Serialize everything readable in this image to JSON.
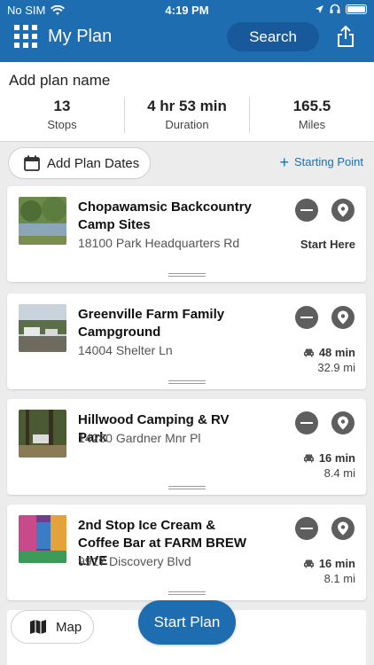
{
  "status_bar": {
    "carrier": "No SIM",
    "time": "4:19 PM"
  },
  "nav": {
    "title": "My Plan",
    "search_label": "Search"
  },
  "plan": {
    "name_placeholder": "Add plan name",
    "stats": [
      {
        "value": "13",
        "label": "Stops"
      },
      {
        "value": "4 hr 53 min",
        "label": "Duration"
      },
      {
        "value": "165.5",
        "label": "Miles"
      }
    ]
  },
  "actions": {
    "add_dates_label": "Add Plan Dates",
    "starting_point_label": "Starting Point"
  },
  "stops": [
    {
      "title": "Chopawamsic Backcountry Camp Sites",
      "address": "18100 Park Headquarters Rd",
      "start_label": "Start Here"
    },
    {
      "title": "Greenville Farm Family Campground",
      "address": "14004 Shelter Ln",
      "drive_time": "48 min",
      "distance": "32.9 mi"
    },
    {
      "title": "Hillwood Camping & RV Park",
      "address": "14280 Gardner Mnr Pl",
      "drive_time": "16 min",
      "distance": "8.4 mi"
    },
    {
      "title": "2nd Stop Ice Cream & Coffee Bar at FARM BREW LIVE",
      "address": "9917 Discovery Blvd",
      "drive_time": "16 min",
      "distance": "8.1 mi"
    }
  ],
  "footer": {
    "map_label": "Map",
    "start_plan_label": "Start Plan"
  },
  "colors": {
    "primary": "#1d6db0",
    "icon_gray": "#5e5e5e"
  }
}
